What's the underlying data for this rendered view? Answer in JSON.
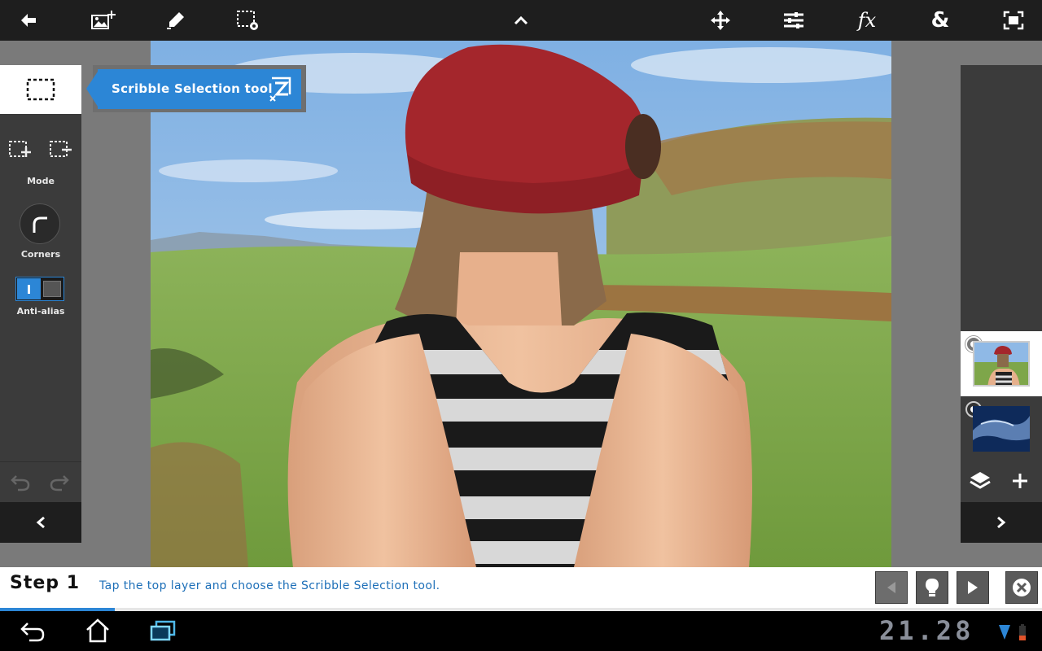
{
  "toolbar": {
    "icons": [
      "back-arrow-icon",
      "add-image-icon",
      "brush-icon",
      "selection-settings-icon",
      "collapse-chevron-icon",
      "move-icon",
      "adjustments-icon",
      "effects-icon",
      "blend-icon",
      "fit-screen-icon"
    ],
    "fx_label": "fx",
    "blend_label": "&"
  },
  "tooltip": {
    "label": "Scribble Selection tool"
  },
  "left_panel": {
    "mode_label": "Mode",
    "corners_label": "Corners",
    "antialias_label": "Anti-alias",
    "antialias_on": true
  },
  "right_panel": {
    "layers": [
      "photo-layer",
      "sky-layer"
    ],
    "selected_layer_index": 0
  },
  "step": {
    "title": "Step 1",
    "instruction": "Tap the top layer and choose the Scribble Selection tool.",
    "progress_fraction": 0.11
  },
  "system": {
    "clock": "21.28"
  },
  "colors": {
    "accent": "#2c86d6",
    "toolbar_bg": "#1e1e1e",
    "panel_bg": "#3b3b3b"
  }
}
